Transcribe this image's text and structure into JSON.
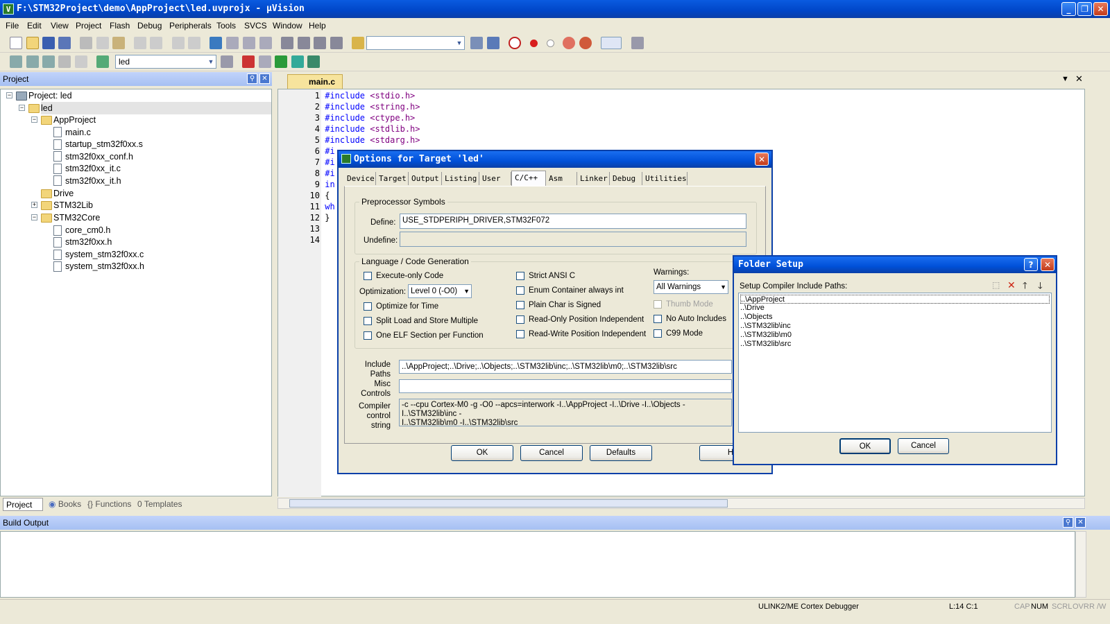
{
  "window": {
    "title": "F:\\STM32Project\\demo\\AppProject\\led.uvprojx - µVision"
  },
  "menu": [
    "File",
    "Edit",
    "View",
    "Project",
    "Flash",
    "Debug",
    "Peripherals",
    "Tools",
    "SVCS",
    "Window",
    "Help"
  ],
  "toolbar": {
    "target_combo": "led",
    "search_combo": ""
  },
  "project_panel": {
    "title": "Project",
    "root": "Project: led",
    "target": "led",
    "groups": {
      "app": {
        "name": "AppProject",
        "files": [
          "main.c",
          "startup_stm32f0xx.s",
          "stm32f0xx_conf.h",
          "stm32f0xx_it.c",
          "stm32f0xx_it.h"
        ]
      },
      "drive": {
        "name": "Drive"
      },
      "lib": {
        "name": "STM32Lib"
      },
      "core": {
        "name": "STM32Core",
        "files": [
          "core_cm0.h",
          "stm32f0xx.h",
          "system_stm32f0xx.c",
          "system_stm32f0xx.h"
        ]
      }
    },
    "tabs": [
      "Project",
      "Books",
      "Functions",
      "Templates"
    ]
  },
  "editor": {
    "tab": "main.c",
    "lines": [
      {
        "n": "1",
        "kw": "#include",
        "rest": "<stdio.h>"
      },
      {
        "n": "2",
        "kw": "#include",
        "rest": "<string.h>"
      },
      {
        "n": "3",
        "kw": "#include",
        "rest": "<ctype.h>"
      },
      {
        "n": "4",
        "kw": "#include",
        "rest": "<stdlib.h>"
      },
      {
        "n": "5",
        "kw": "#include",
        "rest": "<stdarg.h>"
      },
      {
        "n": "6",
        "kw": "#i",
        "rest": ""
      },
      {
        "n": "7",
        "kw": "#i",
        "rest": ""
      },
      {
        "n": "8",
        "kw": "#i",
        "rest": ""
      },
      {
        "n": "9",
        "kw": "in",
        "rest": ""
      },
      {
        "n": "10",
        "kw": "",
        "rest": "{"
      },
      {
        "n": "11",
        "kw": "wh",
        "rest": ""
      },
      {
        "n": "12",
        "kw": "",
        "rest": "}"
      },
      {
        "n": "13",
        "kw": "",
        "rest": ""
      },
      {
        "n": "14",
        "kw": "",
        "rest": ""
      }
    ]
  },
  "options_dialog": {
    "title": "Options for Target 'led'",
    "tabs": [
      "Device",
      "Target",
      "Output",
      "Listing",
      "User",
      "C/C++",
      "Asm",
      "Linker",
      "Debug",
      "Utilities"
    ],
    "preprocessor": {
      "group": "Preprocessor Symbols",
      "define_label": "Define:",
      "define_value": "USE_STDPERIPH_DRIVER,STM32F072",
      "undefine_label": "Undefine:",
      "undefine_value": ""
    },
    "codegen": {
      "group": "Language / Code Generation",
      "execute_only": "Execute-only Code",
      "optimization_label": "Optimization:",
      "optimization_value": "Level 0 (-O0)",
      "optimize_time": "Optimize for Time",
      "split_load": "Split Load and Store Multiple",
      "one_elf": "One ELF Section per Function",
      "strict_ansi": "Strict ANSI C",
      "enum_container": "Enum Container always int",
      "plain_char": "Plain Char is Signed",
      "ro_pos": "Read-Only Position Independent",
      "rw_pos": "Read-Write Position Independent",
      "warnings_label": "Warnings:",
      "warnings_value": "All Warnings",
      "thumb_mode": "Thumb Mode",
      "no_auto": "No Auto Includes",
      "c99": "C99 Mode"
    },
    "include_label_1": "Include",
    "include_label_2": "Paths",
    "include_value": "..\\AppProject;..\\Drive;..\\Objects;..\\STM32lib\\inc;..\\STM32lib\\m0;..\\STM32lib\\src",
    "misc_label_1": "Misc",
    "misc_label_2": "Controls",
    "misc_value": "",
    "compiler_label_1": "Compiler",
    "compiler_label_2": "control",
    "compiler_label_3": "string",
    "compiler_line_1": "-c --cpu Cortex-M0 -g -O0 --apcs=interwork -I..\\AppProject -I..\\Drive -I..\\Objects -I..\\STM32lib\\inc -",
    "compiler_line_2": "I..\\STM32lib\\m0 -I..\\STM32lib\\src",
    "ok": "OK",
    "cancel": "Cancel",
    "defaults": "Defaults",
    "help": "H"
  },
  "folder_dialog": {
    "title": "Folder Setup",
    "label": "Setup Compiler Include Paths:",
    "paths": [
      "..\\AppProject",
      "..\\Drive",
      "..\\Objects",
      "..\\STM32lib\\inc",
      "..\\STM32lib\\m0",
      "..\\STM32lib\\src"
    ],
    "ok": "OK",
    "cancel": "Cancel"
  },
  "build_output": {
    "title": "Build Output",
    "text": ""
  },
  "status": {
    "debugger": "ULINK2/ME Cortex Debugger",
    "position": "L:14 C:1",
    "cap": "CAP",
    "num": "NUM",
    "scrl": "SCRL",
    "ovr": "OVR",
    "rw": "R /W"
  },
  "colors": {
    "title_blue": "#0a5be0",
    "panel_head": "#a6c0f2",
    "keyword": "#0000ff",
    "include": "#800080"
  }
}
